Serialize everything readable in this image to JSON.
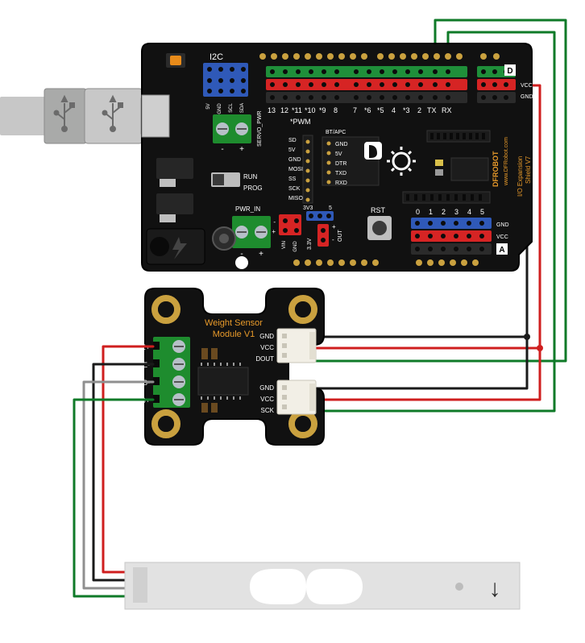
{
  "arduino_board": {
    "brand_line1": "www.DFRobot.com",
    "brand_line2": "DFROBOT",
    "shield_name_line1": "I/O Expansion",
    "shield_name_line2": "Shield V7",
    "i2c_label": "I2C",
    "i2c_pins": [
      "5V",
      "GND",
      "SCL",
      "SDA"
    ],
    "digital_section_label": "D",
    "digital_pins": [
      "13",
      "12",
      "*11",
      "*10",
      "*9",
      "8",
      "7",
      "*6",
      "*5",
      "4",
      "*3",
      "2",
      "TX",
      "RX"
    ],
    "digital_vcc": "VCC",
    "digital_gnd": "GND",
    "pwm_label": "*PWM",
    "btapc_label": "BT/APC",
    "uart_pins": [
      "GND",
      "5V",
      "DTR",
      "TXD",
      "RXD"
    ],
    "sd_pins": [
      "SD",
      "5V",
      "GND",
      "MOSI",
      "SS",
      "SCK",
      "MISO"
    ],
    "mode_run": "RUN",
    "mode_prog": "PROG",
    "servo_pwr": "SERVO_PWR",
    "pwr_in_label": "PWR_IN",
    "vin_label": "VIN",
    "gnd_label": "GND",
    "volt_label_3v3": "3V3",
    "volt_label_5": "5",
    "out_label": "OUT",
    "volt_33v": "3.3V",
    "rst_label": "RST",
    "analog_label": "A",
    "analog_pins": [
      "0",
      "1",
      "2",
      "3",
      "4",
      "5"
    ],
    "analog_gnd": "GND",
    "analog_vcc": "VCC"
  },
  "sensor_module": {
    "title_line1": "Weight Sensor",
    "title_line2": "Module V1",
    "left_terminals": [
      "E+",
      "E-",
      "S-",
      "S+"
    ],
    "conn1_pins": [
      "GND",
      "VCC",
      "DOUT"
    ],
    "conn2_pins": [
      "GND",
      "VCC",
      "SCK"
    ]
  },
  "load_cell": {
    "arrow_symbol": "↓"
  },
  "colors": {
    "pcb_black": "#111111",
    "pcb_edge": "#0a0a0a",
    "silk_white": "#ffffff",
    "silk_orange": "#e89a2a",
    "header_blue": "#2f59b8",
    "header_red": "#d62424",
    "header_green": "#1f8f3a",
    "screw_green": "#1e8c2e",
    "screw_slot": "#b7c0c8",
    "pad_gold": "#caa13f",
    "usb_grey": "#a9aaa9",
    "cable_grey": "#c7c7c7",
    "wire_green": "#0f7a28",
    "wire_red": "#cf1e1e",
    "wire_black": "#1a1a1a",
    "wire_grey": "#8f8f8f",
    "load_cell": "#e2e2e2",
    "orange_btn": "#e88b1a"
  }
}
